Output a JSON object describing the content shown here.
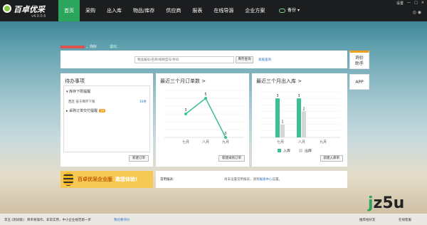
{
  "app": {
    "name": "百卓优采",
    "version": "v4.0.0.6"
  },
  "nav": [
    "首页",
    "采购",
    "出入库",
    "物品/库存",
    "供应商",
    "报表",
    "在线导源",
    "企业方案"
  ],
  "sync_label": "备份",
  "window_controls": [
    "设置",
    "—",
    "□",
    "×"
  ],
  "welcome": {
    "greeting": "，你好",
    "link": "退出"
  },
  "search": {
    "placeholder": "物品编号/名称/规格型号/条码",
    "button": "库存查询",
    "advanced": "高级查询"
  },
  "side": {
    "tab1": "询价助手",
    "tab2": "APP"
  },
  "todo": {
    "title": "待办事项",
    "sections": [
      {
        "label": "库存下限提醒",
        "rows": [
          {
            "text": "西区 低于库存下限",
            "count": "10条"
          }
        ]
      },
      {
        "label": "采购订单交付提醒",
        "badge": "19"
      }
    ],
    "button": "新建订单"
  },
  "orders_panel": {
    "title": "最近三个月订单数 >",
    "button": "新建采购订单"
  },
  "stock_panel": {
    "title": "最近三个月出入库 >",
    "button": "新建入库单"
  },
  "banner": {
    "text": "百卓优采企业版",
    "text2": "邀您体验!"
  },
  "common_reports": {
    "label": "常用报表：",
    "msg_prefix": "尚未设置常用报表，请到",
    "msg_link": "报表中心",
    "msg_suffix": "设置。"
  },
  "statusbar": {
    "left": "李玉 (测试版)：简单易操作，非常实用，中小企业规范第一步",
    "mid": "我也要评价",
    "right1": "推荐给好友",
    "right2": "在线客服"
  },
  "watermark": {
    "j": "j",
    "rest": "z5u"
  },
  "chart_data": [
    {
      "type": "line",
      "title": "最近三个月订单数 >",
      "categories": [
        "七月",
        "八月",
        "九月"
      ],
      "series": [
        {
          "values": [
            3,
            5,
            0
          ]
        }
      ],
      "ylim": [
        0,
        6
      ],
      "grid": true,
      "color": "#3cbf95"
    },
    {
      "type": "bar",
      "title": "最近三个月出入库 >",
      "categories": [
        "七月",
        "八月",
        "九月"
      ],
      "series": [
        {
          "name": "入库",
          "values": [
            3,
            3,
            0
          ],
          "color": "#3cbf95"
        },
        {
          "name": "出库",
          "values": [
            1,
            2,
            0
          ],
          "color": "#d6d6d6"
        }
      ],
      "ylim": [
        0,
        3.5
      ],
      "grid": true,
      "legend": "bottom"
    }
  ]
}
